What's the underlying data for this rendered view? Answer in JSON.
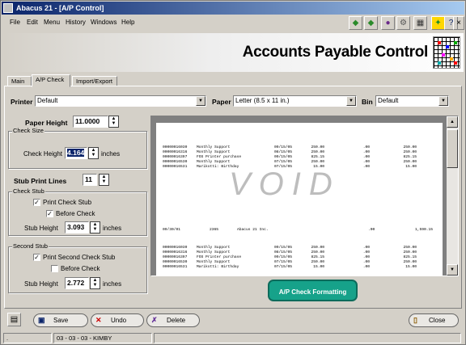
{
  "window": {
    "title": "Abacus 21 - [A/P Control]",
    "controls": {
      "minimize": "_",
      "maximize": "□",
      "close": "x"
    }
  },
  "menu": {
    "items": [
      "File",
      "Edit",
      "Menu",
      "History",
      "Windows",
      "Help"
    ]
  },
  "toolbar": {
    "icons": [
      "back-arrow-icon",
      "forward-arrow-icon",
      "flag-icon",
      "gear-icon",
      "calculator-icon",
      "exit-figure-icon",
      "help-icon",
      "close-icon"
    ]
  },
  "banner": {
    "title": "Accounts Payable Control"
  },
  "tabs": [
    {
      "label": "Main"
    },
    {
      "label": "A/P Check"
    },
    {
      "label": "Import/Export"
    }
  ],
  "form": {
    "printer_label": "Printer",
    "printer_value": "Default",
    "paper_label": "Paper",
    "paper_value": "Letter (8.5 x 11 in.)",
    "bin_label": "Bin",
    "bin_value": "Default",
    "paper_height_label": "Paper Height",
    "paper_height_value": "11.0000",
    "check_size_group": "Check Size",
    "check_height_label": "Check Height",
    "check_height_value": "4.164",
    "check_height_unit": "inches",
    "stub_print_lines_label": "Stub Print Lines",
    "stub_print_lines_value": "11",
    "check_stub_group": "Check Stub",
    "print_check_stub_label": "Print Check Stub",
    "before_check_label": "Before Check",
    "stub_height_label": "Stub Height",
    "stub_height_value": "3.093",
    "stub_height_unit": "inches",
    "second_stub_group": "Second Stub",
    "print_second_stub_label": "Print Second Check Stub",
    "before_check2_label": "Before Check",
    "stub_height2_label": "Stub Height",
    "stub_height2_value": "2.772",
    "stub_height2_unit": "inches",
    "checks": {
      "print_check_stub": true,
      "before_check": true,
      "print_second_stub": true,
      "before_check2": false
    }
  },
  "preview": {
    "void_text": "VOID",
    "top_rows": [
      [
        "00000016030",
        "Monthly Support",
        "09/15/05",
        "250.00",
        ".00",
        "250.00"
      ],
      [
        "00000016316",
        "Monthly Support",
        "08/15/05",
        "250.00",
        ".00",
        "250.00"
      ],
      [
        "00000016397",
        "FOS Printer purchase",
        "09/15/05",
        "825.15",
        ".00",
        "825.15"
      ],
      [
        "00000016530",
        "Monthly Support",
        "07/15/05",
        "250.00",
        ".00",
        "250.00"
      ],
      [
        "00000016531",
        "Marikotti: Birthday",
        "07/15/05",
        "15.00",
        ".00",
        "15.00"
      ]
    ],
    "check_line": [
      "09/30/01",
      "2365",
      "Abacus 21 Inc.",
      ".00",
      "1,590.15"
    ],
    "bottom_rows": [
      [
        "00000016030",
        "Monthly Support",
        "09/15/05",
        "250.00",
        ".00",
        "250.00"
      ],
      [
        "00000016316",
        "Monthly Support",
        "08/15/05",
        "250.00",
        ".00",
        "250.00"
      ],
      [
        "00000016397",
        "FOS Printer purchase",
        "09/15/05",
        "825.15",
        ".00",
        "825.15"
      ],
      [
        "00000016530",
        "Monthly Support",
        "07/15/05",
        "250.00",
        ".00",
        "250.00"
      ],
      [
        "00000016531",
        "Marikotti: Birthday",
        "07/15/05",
        "15.00",
        ".00",
        "15.00"
      ]
    ]
  },
  "formatting_button": "A/P Check Formatting",
  "footer": {
    "save": "Save",
    "undo": "Undo",
    "delete": "Delete",
    "close": "Close"
  },
  "status": {
    "dot": ".",
    "date_user": "03 - 03 - 03 - KIMBY"
  }
}
